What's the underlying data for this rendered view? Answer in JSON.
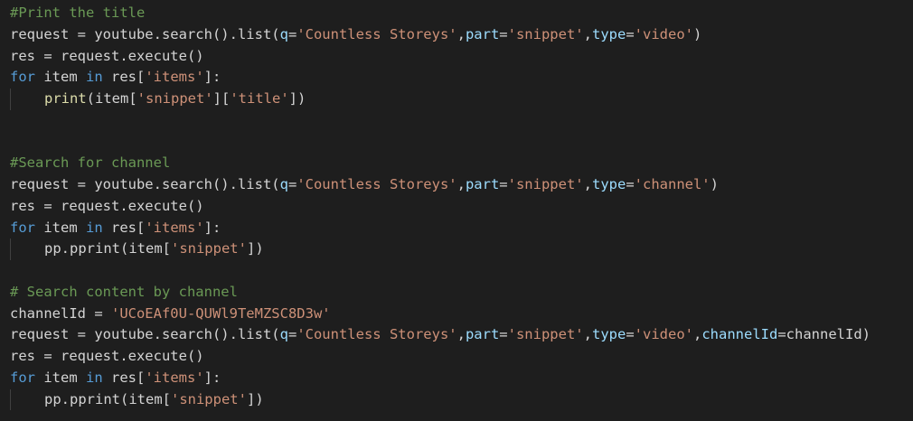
{
  "theme": {
    "background": "#1e1e1e",
    "default_text": "#d4d4d4",
    "comment": "#6a9955",
    "keyword": "#569cd6",
    "string": "#ce9178",
    "parameter": "#9cdcfe",
    "function": "#dcdcaa",
    "indent_guide": "#404040"
  },
  "code_lines": [
    {
      "indent": false,
      "tokens": [
        {
          "t": "#Print the title",
          "c": "comment"
        }
      ]
    },
    {
      "indent": false,
      "tokens": [
        {
          "t": "request = youtube.search().list(",
          "c": "default"
        },
        {
          "t": "q",
          "c": "param"
        },
        {
          "t": "=",
          "c": "default"
        },
        {
          "t": "'Countless Storeys'",
          "c": "string"
        },
        {
          "t": ",",
          "c": "default"
        },
        {
          "t": "part",
          "c": "param"
        },
        {
          "t": "=",
          "c": "default"
        },
        {
          "t": "'snippet'",
          "c": "string"
        },
        {
          "t": ",",
          "c": "default"
        },
        {
          "t": "type",
          "c": "param"
        },
        {
          "t": "=",
          "c": "default"
        },
        {
          "t": "'video'",
          "c": "string"
        },
        {
          "t": ")",
          "c": "default"
        }
      ]
    },
    {
      "indent": false,
      "tokens": [
        {
          "t": "res = request.execute()",
          "c": "default"
        }
      ]
    },
    {
      "indent": false,
      "tokens": [
        {
          "t": "for",
          "c": "keyword"
        },
        {
          "t": " item ",
          "c": "default"
        },
        {
          "t": "in",
          "c": "keyword"
        },
        {
          "t": " res[",
          "c": "default"
        },
        {
          "t": "'items'",
          "c": "string"
        },
        {
          "t": "]:",
          "c": "default"
        }
      ]
    },
    {
      "indent": true,
      "tokens": [
        {
          "t": "print",
          "c": "func"
        },
        {
          "t": "(item[",
          "c": "default"
        },
        {
          "t": "'snippet'",
          "c": "string"
        },
        {
          "t": "][",
          "c": "default"
        },
        {
          "t": "'title'",
          "c": "string"
        },
        {
          "t": "])",
          "c": "default"
        }
      ]
    },
    {
      "indent": false,
      "tokens": []
    },
    {
      "indent": false,
      "tokens": []
    },
    {
      "indent": false,
      "tokens": [
        {
          "t": "#Search for channel",
          "c": "comment"
        }
      ]
    },
    {
      "indent": false,
      "tokens": [
        {
          "t": "request = youtube.search().list(",
          "c": "default"
        },
        {
          "t": "q",
          "c": "param"
        },
        {
          "t": "=",
          "c": "default"
        },
        {
          "t": "'Countless Storeys'",
          "c": "string"
        },
        {
          "t": ",",
          "c": "default"
        },
        {
          "t": "part",
          "c": "param"
        },
        {
          "t": "=",
          "c": "default"
        },
        {
          "t": "'snippet'",
          "c": "string"
        },
        {
          "t": ",",
          "c": "default"
        },
        {
          "t": "type",
          "c": "param"
        },
        {
          "t": "=",
          "c": "default"
        },
        {
          "t": "'channel'",
          "c": "string"
        },
        {
          "t": ")",
          "c": "default"
        }
      ]
    },
    {
      "indent": false,
      "tokens": [
        {
          "t": "res = request.execute()",
          "c": "default"
        }
      ]
    },
    {
      "indent": false,
      "tokens": [
        {
          "t": "for",
          "c": "keyword"
        },
        {
          "t": " item ",
          "c": "default"
        },
        {
          "t": "in",
          "c": "keyword"
        },
        {
          "t": " res[",
          "c": "default"
        },
        {
          "t": "'items'",
          "c": "string"
        },
        {
          "t": "]:",
          "c": "default"
        }
      ]
    },
    {
      "indent": true,
      "tokens": [
        {
          "t": "pp.pprint(item[",
          "c": "default"
        },
        {
          "t": "'snippet'",
          "c": "string"
        },
        {
          "t": "])",
          "c": "default"
        }
      ]
    },
    {
      "indent": false,
      "tokens": []
    },
    {
      "indent": false,
      "tokens": [
        {
          "t": "# Search content by channel",
          "c": "comment"
        }
      ]
    },
    {
      "indent": false,
      "tokens": [
        {
          "t": "channelId = ",
          "c": "default"
        },
        {
          "t": "'UCoEAf0U-QUWl9TeMZSC8D3w'",
          "c": "string"
        }
      ]
    },
    {
      "indent": false,
      "tokens": [
        {
          "t": "request = youtube.search().list(",
          "c": "default"
        },
        {
          "t": "q",
          "c": "param"
        },
        {
          "t": "=",
          "c": "default"
        },
        {
          "t": "'Countless Storeys'",
          "c": "string"
        },
        {
          "t": ",",
          "c": "default"
        },
        {
          "t": "part",
          "c": "param"
        },
        {
          "t": "=",
          "c": "default"
        },
        {
          "t": "'snippet'",
          "c": "string"
        },
        {
          "t": ",",
          "c": "default"
        },
        {
          "t": "type",
          "c": "param"
        },
        {
          "t": "=",
          "c": "default"
        },
        {
          "t": "'video'",
          "c": "string"
        },
        {
          "t": ",",
          "c": "default"
        },
        {
          "t": "channelId",
          "c": "param"
        },
        {
          "t": "=channelId)",
          "c": "default"
        }
      ]
    },
    {
      "indent": false,
      "tokens": [
        {
          "t": "res = request.execute()",
          "c": "default"
        }
      ]
    },
    {
      "indent": false,
      "tokens": [
        {
          "t": "for",
          "c": "keyword"
        },
        {
          "t": " item ",
          "c": "default"
        },
        {
          "t": "in",
          "c": "keyword"
        },
        {
          "t": " res[",
          "c": "default"
        },
        {
          "t": "'items'",
          "c": "string"
        },
        {
          "t": "]:",
          "c": "default"
        }
      ]
    },
    {
      "indent": true,
      "tokens": [
        {
          "t": "pp.pprint(item[",
          "c": "default"
        },
        {
          "t": "'snippet'",
          "c": "string"
        },
        {
          "t": "])",
          "c": "default"
        }
      ]
    }
  ]
}
